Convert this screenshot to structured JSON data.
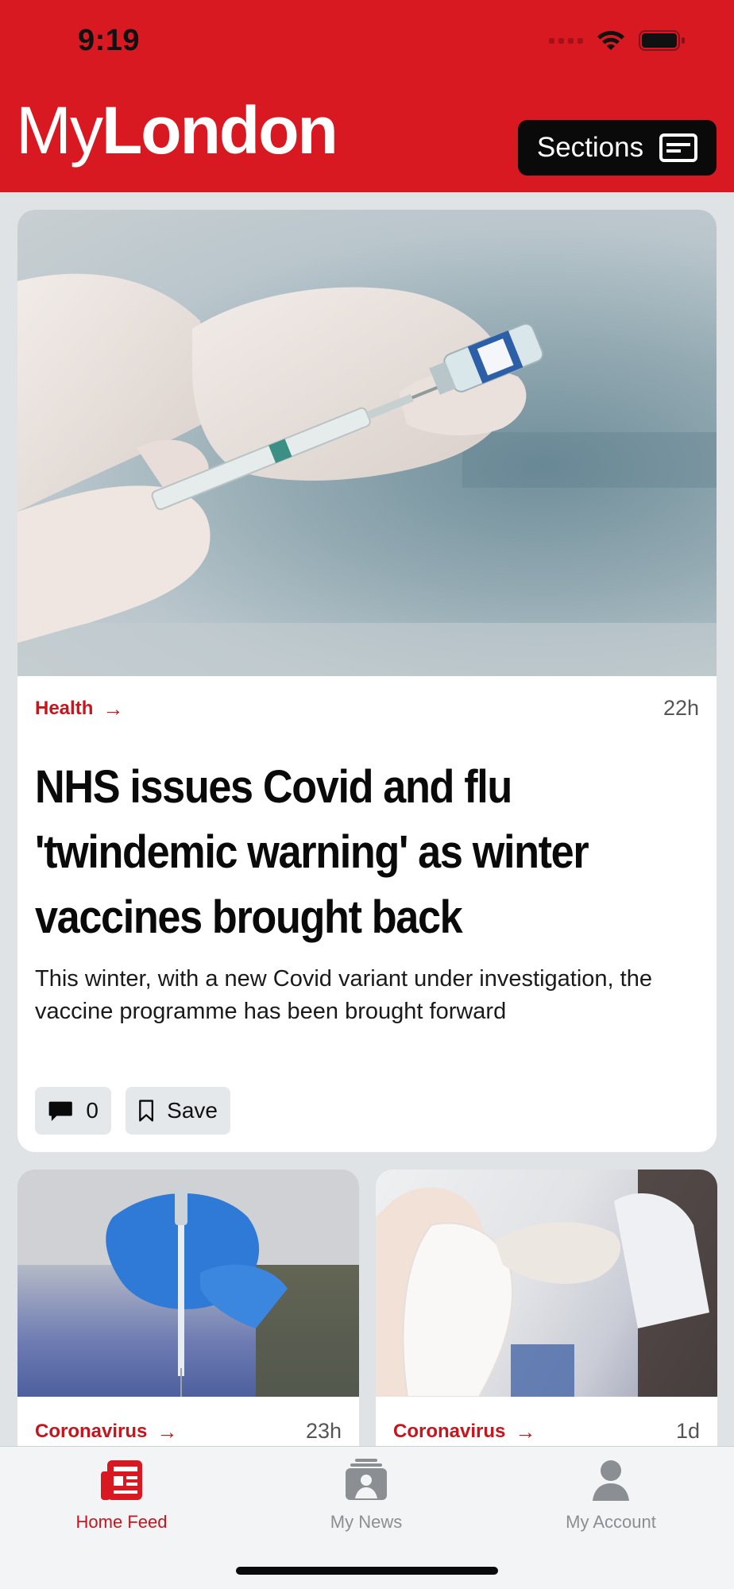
{
  "status_bar": {
    "time": "9:19"
  },
  "header": {
    "logo_my": "My",
    "logo_london": "London",
    "sections_label": "Sections"
  },
  "main_article": {
    "category": "Health",
    "time": "22h",
    "headline": "NHS issues Covid and flu 'twindemic warning' as winter vaccines brought back",
    "standfirst": "This winter, with a new Covid variant under investigation, the vaccine programme has been brought forward",
    "comment_count": "0",
    "save_label": "Save"
  },
  "articles": [
    {
      "category": "Coronavirus",
      "time": "23h"
    },
    {
      "category": "Coronavirus",
      "time": "1d"
    }
  ],
  "tabbar": {
    "items": [
      {
        "label": "Home Feed",
        "icon": "newspaper-icon",
        "active": true
      },
      {
        "label": "My News",
        "icon": "my-news-icon",
        "active": false
      },
      {
        "label": "My Account",
        "icon": "person-icon",
        "active": false
      }
    ]
  },
  "colors": {
    "brand_red": "#d81921",
    "category_red": "#c8141c",
    "inactive_tab": "#8b8f93"
  }
}
